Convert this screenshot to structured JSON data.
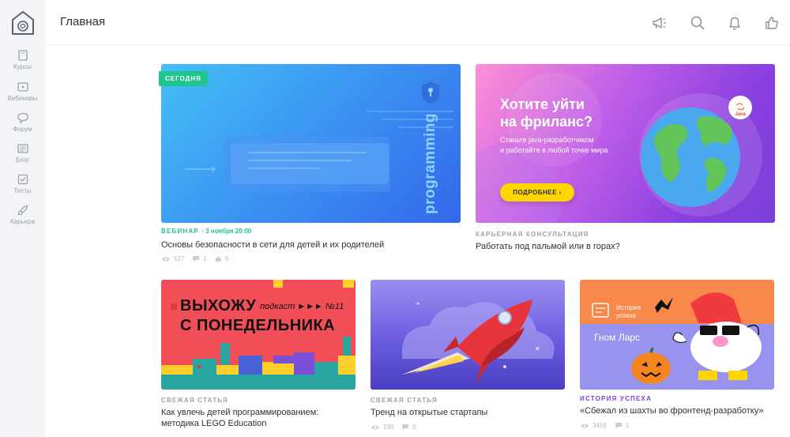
{
  "header": {
    "title": "Главная"
  },
  "sidebar": {
    "items": [
      {
        "label": "Курсы",
        "icon": "book-icon"
      },
      {
        "label": "Вебинары",
        "icon": "video-icon"
      },
      {
        "label": "Форум",
        "icon": "chat-icon"
      },
      {
        "label": "Блог",
        "icon": "newspaper-icon"
      },
      {
        "label": "Тесты",
        "icon": "checkbox-icon"
      },
      {
        "label": "Карьера",
        "icon": "rocket-icon"
      }
    ]
  },
  "cards": [
    {
      "badge": "СЕГОДНЯ",
      "image_text": "programming",
      "category": "ВЕБИНАР",
      "date": "· 3 ноября 20:00",
      "title": "Основы безопасности в сети для детей и их родителей",
      "views": "527",
      "comments": "1",
      "likes": "0"
    },
    {
      "banner_title_1": "Хотите уйти",
      "banner_title_2": "на фриланс?",
      "banner_sub_1": "Станьте java-разработчиком",
      "banner_sub_2": "и работайте в любой точке мира",
      "button": "ПОДРОБНЕЕ ›",
      "java_label": "Java",
      "category": "КАРЬЕРНАЯ КОНСУЛЬТАЦИЯ",
      "title": "Работать под пальмой или в горах?"
    },
    {
      "image_line_1": "ВЫХОЖУ",
      "image_podcast": "подкаст ►►► №11",
      "image_line_2": "С ПОНЕДЕЛЬНИКА",
      "category": "СВЕЖАЯ СТАТЬЯ",
      "title": "Как увлечь детей программированием: методика LEGO Education",
      "views": "",
      "comments": "",
      "likes": ""
    },
    {
      "category": "СВЕЖАЯ СТАТЬЯ",
      "title": "Тренд на открытые стартапы",
      "views": "198",
      "comments": "0"
    },
    {
      "image_label_1": "История",
      "image_label_2": "успеха",
      "image_name": "Гном Ларс",
      "category": "ИСТОРИЯ УСПЕХА",
      "title": "«Сбежал из шахты во фронтенд-разработку»",
      "views": "3458",
      "comments": "1"
    }
  ],
  "colors": {
    "accent_green": "#1ec58c",
    "accent_purple": "#7b3fd8",
    "button_yellow": "#ffd600"
  }
}
